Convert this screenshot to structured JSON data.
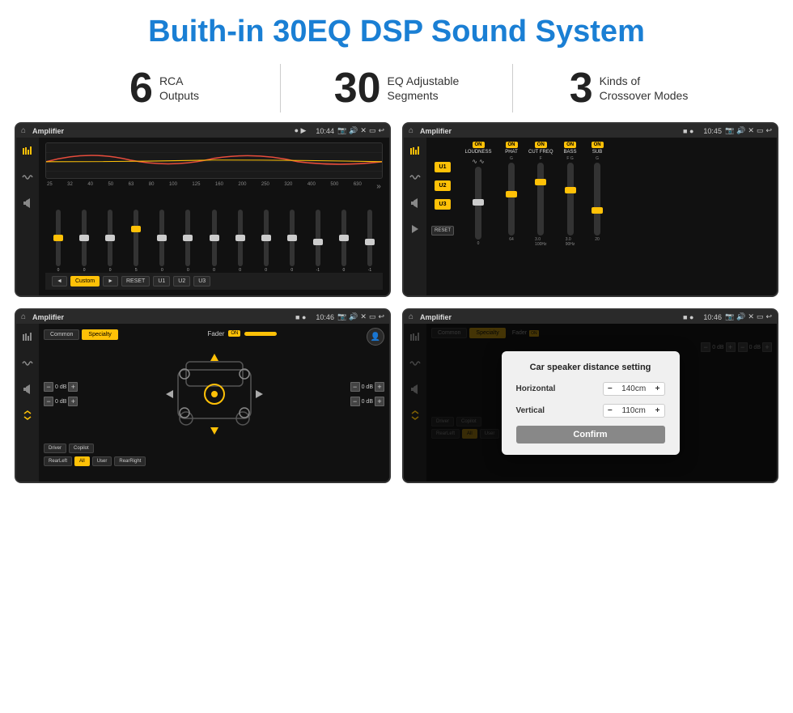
{
  "page": {
    "title": "Buith-in 30EQ DSP Sound System",
    "stats": [
      {
        "number": "6",
        "label": "RCA\nOutputs"
      },
      {
        "number": "30",
        "label": "EQ Adjustable\nSegments"
      },
      {
        "number": "3",
        "label": "Kinds of\nCrossover Modes"
      }
    ]
  },
  "screen1": {
    "statusBar": {
      "title": "Amplifier",
      "time": "10:44"
    },
    "freqLabels": [
      "25",
      "32",
      "40",
      "50",
      "63",
      "80",
      "100",
      "125",
      "160",
      "200",
      "250",
      "320",
      "400",
      "500",
      "630"
    ],
    "sliderValues": [
      "0",
      "0",
      "0",
      "5",
      "0",
      "0",
      "0",
      "0",
      "0",
      "0",
      "-1",
      "0",
      "-1"
    ],
    "buttons": [
      "◄",
      "Custom",
      "►",
      "RESET",
      "U1",
      "U2",
      "U3"
    ]
  },
  "screen2": {
    "statusBar": {
      "title": "Amplifier",
      "time": "10:45"
    },
    "uButtons": [
      "U1",
      "U2",
      "U3"
    ],
    "controls": [
      {
        "label": "LOUDNESS",
        "on": true
      },
      {
        "label": "PHAT",
        "on": true
      },
      {
        "label": "CUT FREQ",
        "on": true
      },
      {
        "label": "BASS",
        "on": true
      },
      {
        "label": "SUB",
        "on": true
      }
    ],
    "resetBtn": "RESET"
  },
  "screen3": {
    "statusBar": {
      "title": "Amplifier",
      "time": "10:46"
    },
    "tabs": [
      "Common",
      "Specialty"
    ],
    "faderLabel": "Fader",
    "faderOn": "ON",
    "dbValues": [
      "0 dB",
      "0 dB",
      "0 dB",
      "0 dB"
    ],
    "buttons": [
      "Driver",
      "Copilot",
      "RearLeft",
      "All",
      "User",
      "RearRight"
    ]
  },
  "screen4": {
    "statusBar": {
      "title": "Amplifier",
      "time": "10:46"
    },
    "tabs": [
      "Common",
      "Specialty"
    ],
    "dialog": {
      "title": "Car speaker distance setting",
      "horizontalLabel": "Horizontal",
      "horizontalValue": "140cm",
      "verticalLabel": "Vertical",
      "verticalValue": "110cm",
      "confirmBtn": "Confirm"
    },
    "dbValues": [
      "0 dB",
      "0 dB"
    ],
    "buttons": [
      "Driver",
      "Copilot",
      "RearLeft",
      "All",
      "User",
      "RearRight"
    ]
  }
}
